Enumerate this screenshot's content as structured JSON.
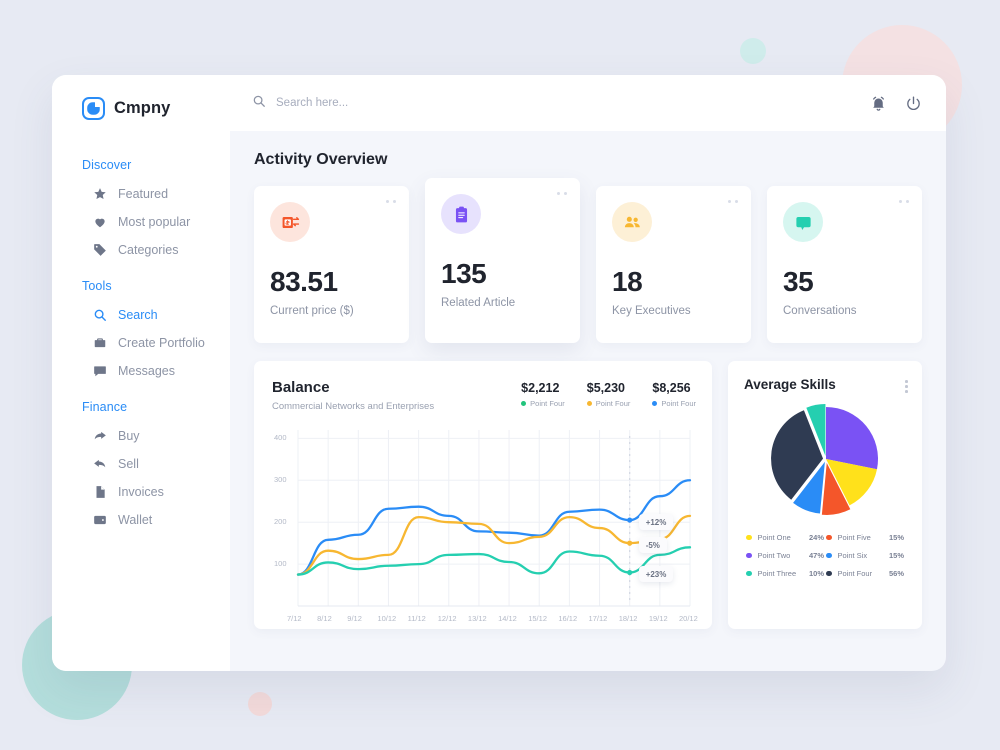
{
  "brand": {
    "name": "Cmpny",
    "logo_icon": "logo-rounded-square-icon",
    "accent": "#2a8cf6"
  },
  "topbar": {
    "search_placeholder": "Search here...",
    "search_value": "",
    "search_icon": "search-icon",
    "notification_icon": "bell-icon",
    "power_icon": "power-icon"
  },
  "sidebar": {
    "groups": [
      {
        "title": "Discover",
        "items": [
          {
            "label": "Featured",
            "icon": "star-icon",
            "active": false
          },
          {
            "label": "Most popular",
            "icon": "heart-icon",
            "active": false
          },
          {
            "label": "Categories",
            "icon": "tag-icon",
            "active": false
          }
        ]
      },
      {
        "title": "Tools",
        "items": [
          {
            "label": "Search",
            "icon": "search-icon",
            "active": true
          },
          {
            "label": "Create Portfolio",
            "icon": "briefcase-icon",
            "active": false
          },
          {
            "label": "Messages",
            "icon": "chat-icon",
            "active": false
          }
        ]
      },
      {
        "title": "Finance",
        "items": [
          {
            "label": "Buy",
            "icon": "arrow-forward-icon",
            "active": false
          },
          {
            "label": "Sell",
            "icon": "arrow-back-icon",
            "active": false
          },
          {
            "label": "Invoices",
            "icon": "document-icon",
            "active": false
          },
          {
            "label": "Wallet",
            "icon": "wallet-icon",
            "active": false
          }
        ]
      }
    ]
  },
  "main": {
    "page_title": "Activity Overview",
    "stats": [
      {
        "value": "83.51",
        "label": "Current price ($)",
        "icon": "money-exchange-icon",
        "icon_color": "#f4562a",
        "icon_bg": "#fde5dd"
      },
      {
        "value": "135",
        "label": "Related Article",
        "icon": "clipboard-icon",
        "icon_color": "#7a52f4",
        "icon_bg": "#e7e2fd"
      },
      {
        "value": "18",
        "label": "Key Executives",
        "icon": "people-icon",
        "icon_color": "#f7b731",
        "icon_bg": "#fdf0d6"
      },
      {
        "value": "35",
        "label": "Conversations",
        "icon": "chat-bubble-icon",
        "icon_color": "#25cfb0",
        "icon_bg": "#d6f6f0"
      }
    ]
  },
  "balance": {
    "title": "Balance",
    "subtitle": "Commercial Networks and Enterprises",
    "stats": [
      {
        "value": "$2,212",
        "legend": "Point Four",
        "color": "#22c47d"
      },
      {
        "value": "$5,230",
        "legend": "Point Four",
        "color": "#f7b731"
      },
      {
        "value": "$8,256",
        "legend": "Point Four",
        "color": "#2a8cf6"
      }
    ],
    "badges": [
      {
        "text": "+12%",
        "color": "#2a8cf6"
      },
      {
        "text": "-5%",
        "color": "#f7b731"
      },
      {
        "text": "+23%",
        "color": "#25cfb0"
      }
    ]
  },
  "skills": {
    "title": "Average Skills",
    "menu_icon": "kebab-menu-icon",
    "legend": [
      {
        "name": "Point One",
        "value": "24%",
        "color": "#ffe11b"
      },
      {
        "name": "Point Five",
        "value": "15%",
        "color": "#f4562a"
      },
      {
        "name": "Point Two",
        "value": "47%",
        "color": "#7a52f4"
      },
      {
        "name": "Point Six",
        "value": "15%",
        "color": "#2a8cf6"
      },
      {
        "name": "Point Three",
        "value": "10%",
        "color": "#25cfb0"
      },
      {
        "name": "Point Four",
        "value": "56%",
        "color": "#2f3b52"
      }
    ]
  },
  "chart_data": [
    {
      "type": "line",
      "title": "Balance",
      "subtitle": "Commercial Networks and Enterprises",
      "xlabel": "",
      "ylabel": "",
      "x": [
        "7/12",
        "8/12",
        "9/12",
        "10/12",
        "11/12",
        "12/12",
        "13/12",
        "14/12",
        "15/12",
        "16/12",
        "17/12",
        "18/12",
        "19/12",
        "20/12"
      ],
      "yticks": [
        100,
        200,
        300,
        400
      ],
      "ylim": [
        0,
        420
      ],
      "grid": true,
      "legend_position": "top-right",
      "marker_line_x": "18/12",
      "series": [
        {
          "name": "Point Four (blue)",
          "color": "#2a8cf6",
          "total": "$8,256",
          "change": "+12%",
          "values": [
            75,
            158,
            170,
            232,
            237,
            215,
            178,
            175,
            168,
            225,
            230,
            205,
            262,
            300
          ]
        },
        {
          "name": "Point Four (orange)",
          "color": "#f7b731",
          "total": "$5,230",
          "change": "-5%",
          "values": [
            75,
            132,
            112,
            122,
            212,
            200,
            196,
            150,
            165,
            212,
            186,
            150,
            160,
            215
          ]
        },
        {
          "name": "Point Four (green)",
          "color": "#25cfb0",
          "total": "$2,212",
          "change": "+23%",
          "values": [
            75,
            104,
            88,
            96,
            100,
            122,
            124,
            105,
            78,
            130,
            120,
            80,
            122,
            140
          ]
        }
      ]
    },
    {
      "type": "pie",
      "title": "Average Skills",
      "labels": [
        "Point One",
        "Point Two",
        "Point Three",
        "Point Four",
        "Point Five",
        "Point Six"
      ],
      "values": [
        24,
        47,
        10,
        56,
        15,
        15
      ],
      "display_values": [
        "24%",
        "47%",
        "10%",
        "56%",
        "15%",
        "15%"
      ],
      "colors": [
        "#ffe11b",
        "#7a52f4",
        "#25cfb0",
        "#2f3b52",
        "#f4562a",
        "#2a8cf6"
      ],
      "legend_position": "bottom"
    }
  ]
}
